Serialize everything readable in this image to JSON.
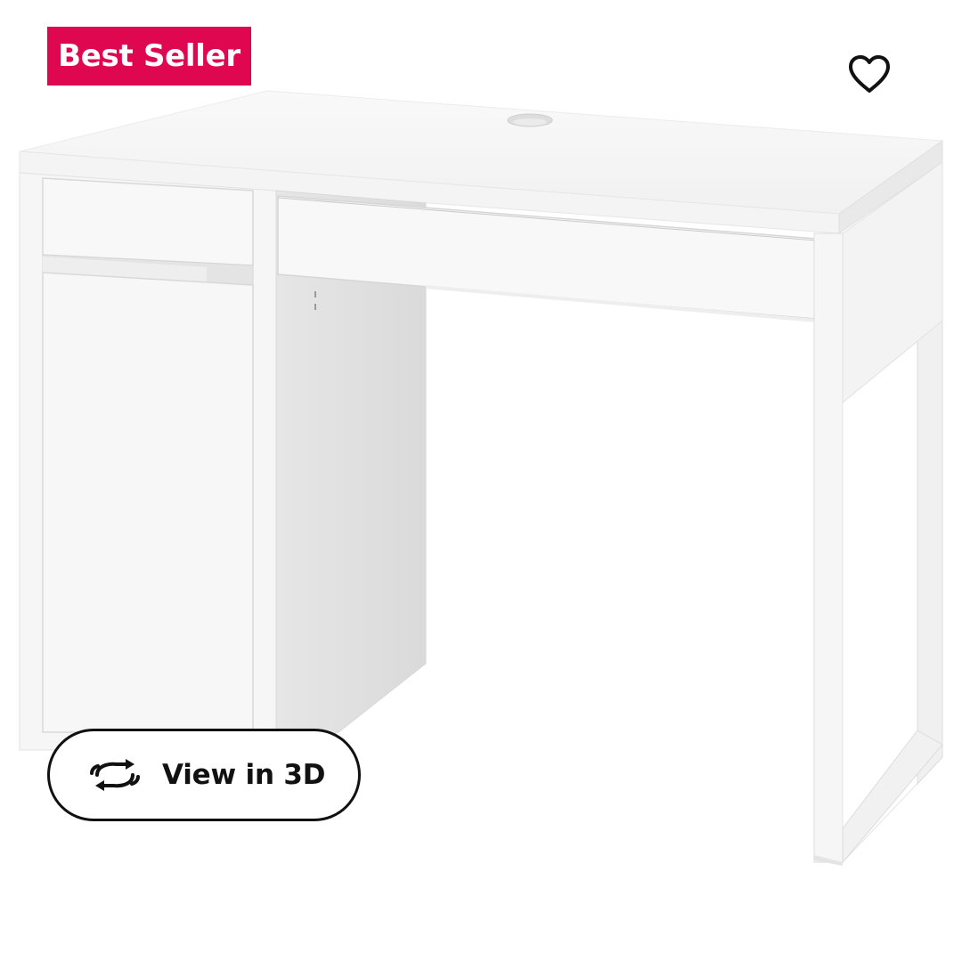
{
  "badge": {
    "label": "Best Seller",
    "color": "#e00751"
  },
  "favorite": {
    "icon": "heart-outline-icon"
  },
  "view_3d": {
    "label": "View in 3D",
    "icon": "rotate-3d-icon"
  },
  "product_image": {
    "subject": "white desk with drawer and cabinet"
  }
}
